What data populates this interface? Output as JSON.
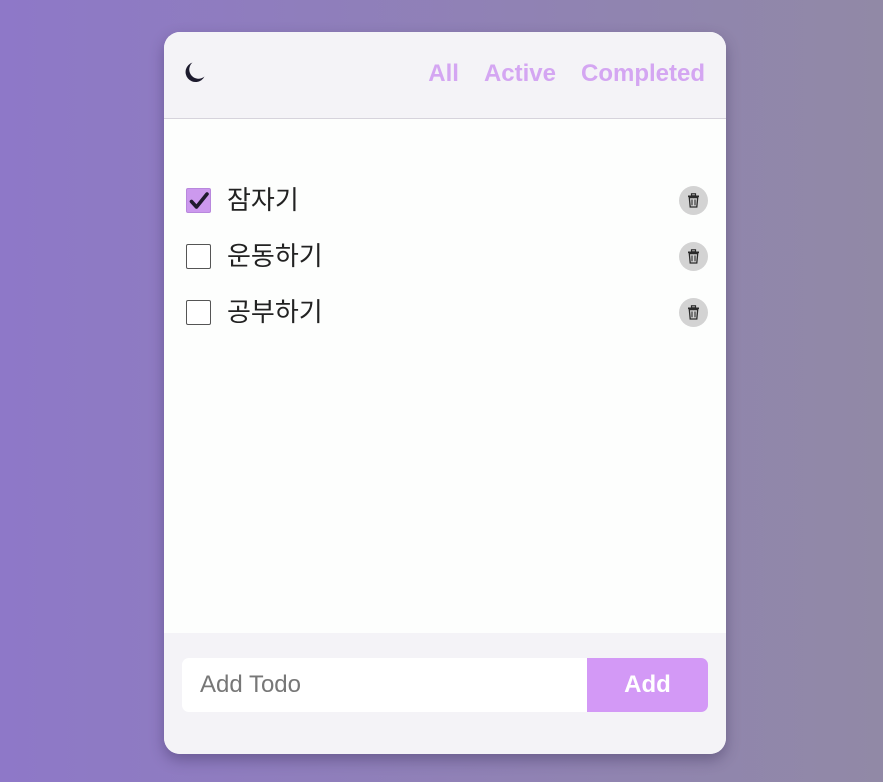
{
  "header": {
    "theme_icon": "moon-icon",
    "filters": [
      {
        "label": "All"
      },
      {
        "label": "Active"
      },
      {
        "label": "Completed"
      }
    ]
  },
  "todos": [
    {
      "text": "잠자기",
      "completed": true
    },
    {
      "text": "운동하기",
      "completed": false
    },
    {
      "text": "공부하기",
      "completed": false
    }
  ],
  "footer": {
    "input_placeholder": "Add Todo",
    "input_value": "",
    "add_label": "Add"
  },
  "colors": {
    "accent": "#d399f6",
    "filter_text": "#d4a6f2",
    "checked_box": "#cc99ee",
    "delete_bg": "#d3d3d3"
  }
}
